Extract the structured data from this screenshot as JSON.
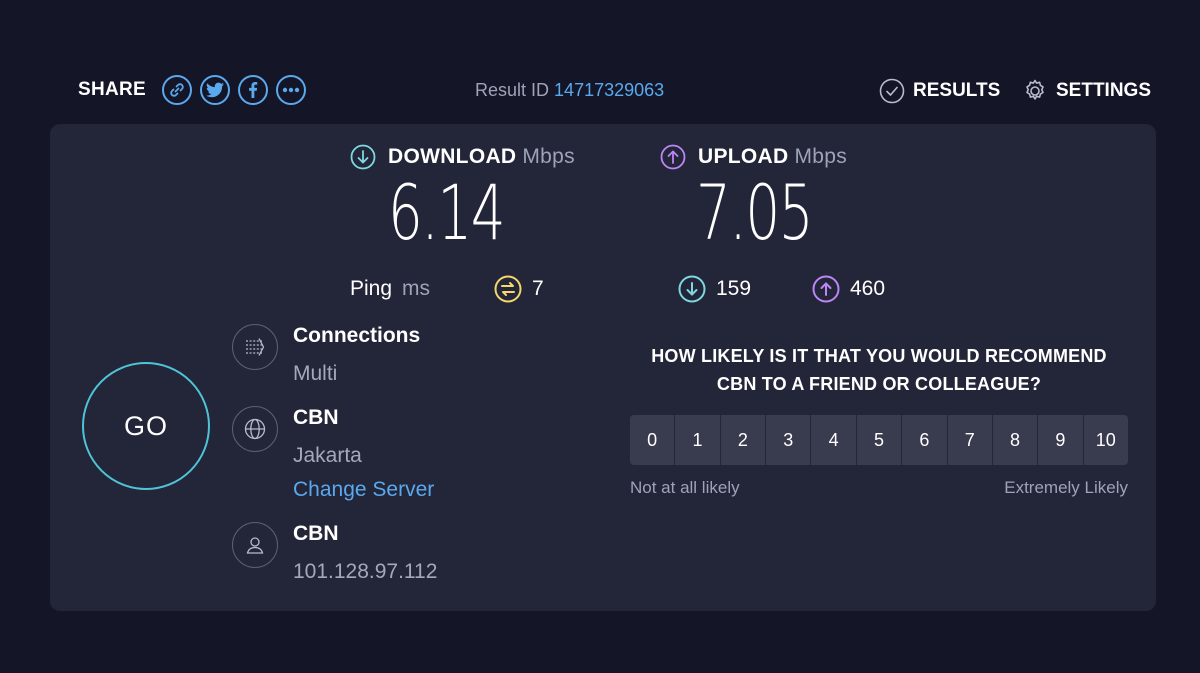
{
  "header": {
    "share_label": "SHARE",
    "share_buttons": [
      {
        "icon": "link-icon"
      },
      {
        "icon": "twitter-icon"
      },
      {
        "icon": "facebook-icon"
      },
      {
        "icon": "more-icon"
      }
    ],
    "result_id_label": "Result ID",
    "result_id_value": "14717329063",
    "results_label": "RESULTS",
    "settings_label": "SETTINGS"
  },
  "download": {
    "label": "DOWNLOAD",
    "unit": "Mbps",
    "value": "6.14",
    "icon": "download-arrow-icon"
  },
  "upload": {
    "label": "UPLOAD",
    "unit": "Mbps",
    "value": "7.05",
    "icon": "upload-arrow-icon"
  },
  "ping": {
    "label": "Ping",
    "unit": "ms",
    "idle": {
      "value": "7",
      "icon": "ping-icon"
    },
    "download": {
      "value": "159",
      "icon": "download-arrow-icon"
    },
    "upload": {
      "value": "460",
      "icon": "upload-arrow-icon"
    }
  },
  "go_label": "GO",
  "connections": {
    "title": "Connections",
    "value": "Multi",
    "icon": "connections-icon"
  },
  "server": {
    "title": "CBN",
    "location": "Jakarta",
    "change_label": "Change Server",
    "icon": "globe-icon"
  },
  "client": {
    "title": "CBN",
    "ip": "101.128.97.112",
    "icon": "user-icon"
  },
  "survey": {
    "question_line1": "HOW LIKELY IS IT THAT YOU WOULD RECOMMEND",
    "question_line2": "CBN TO A FRIEND OR COLLEAGUE?",
    "scale": [
      "0",
      "1",
      "2",
      "3",
      "4",
      "5",
      "6",
      "7",
      "8",
      "9",
      "10"
    ],
    "min_label": "Not at all likely",
    "max_label": "Extremely Likely"
  },
  "colors": {
    "background": "#141526",
    "card": "#232538",
    "accent_link": "#5aa9ee",
    "download": "#7fd8e0",
    "upload": "#bb86f5",
    "ping": "#f5d76e",
    "go_ring": "#4fc4d6"
  }
}
